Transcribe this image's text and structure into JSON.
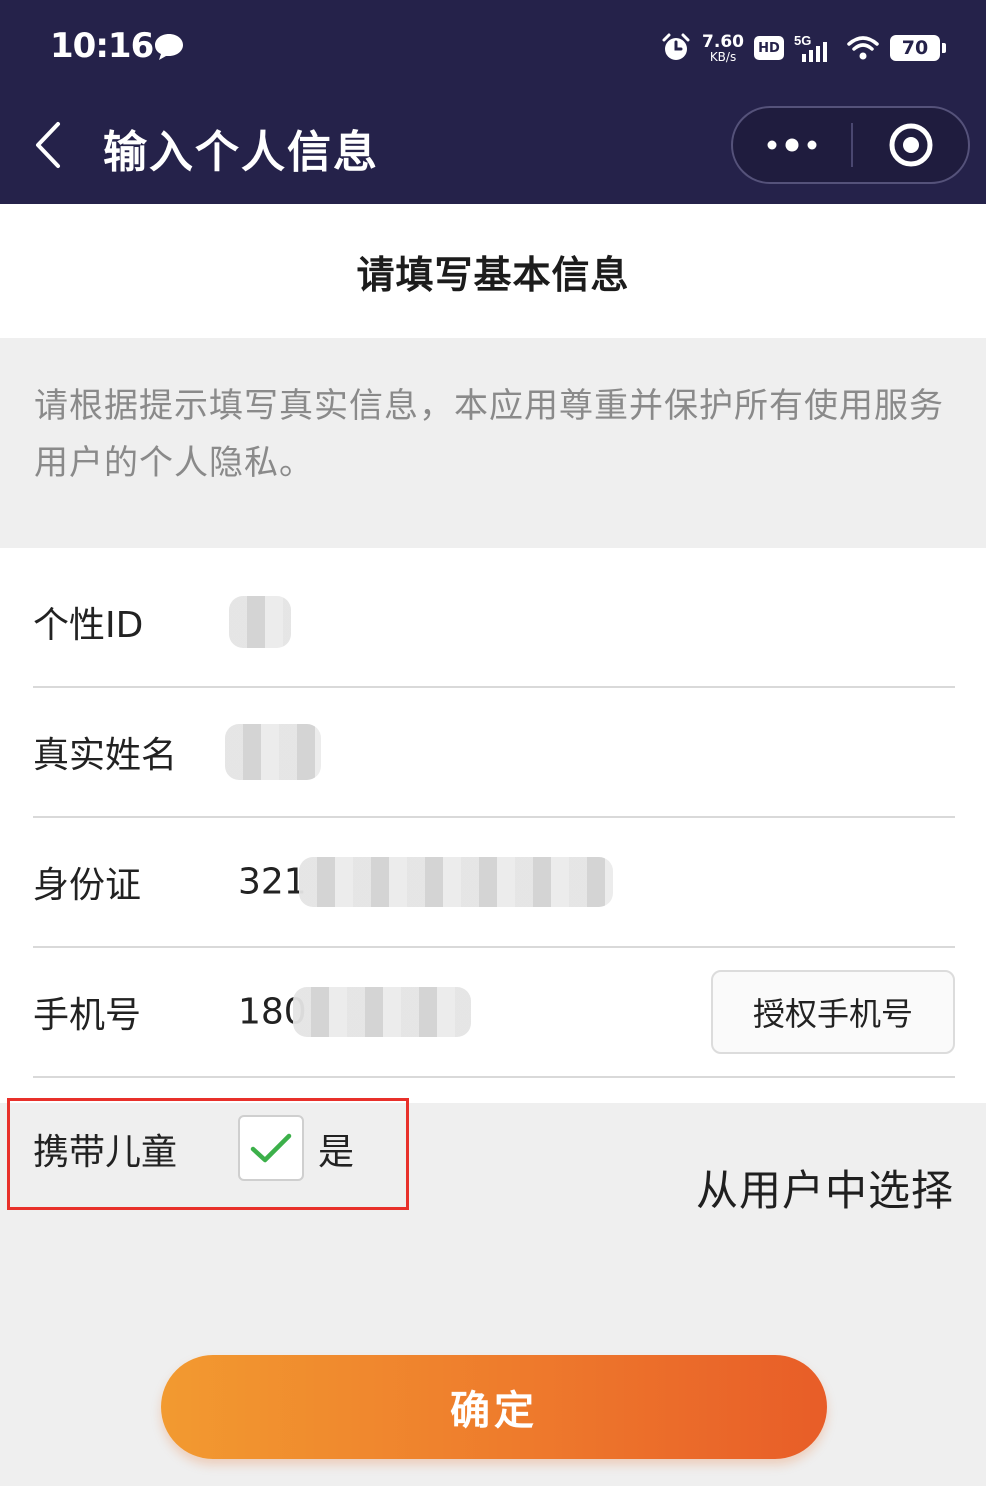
{
  "status_bar": {
    "time": "10:16",
    "net_speed_value": "7.60",
    "net_speed_unit": "KB/s",
    "hd_label": "HD",
    "network": "5G",
    "battery": "70"
  },
  "nav": {
    "title": "输入个人信息",
    "back_icon": "chevron-left-icon",
    "more_icon": "more-dots-icon",
    "close_icon": "target-circle-icon"
  },
  "heading": "请填写基本信息",
  "notice": "请根据提示填写真实信息，本应用尊重并保护所有使用服务用户的个人隐私。",
  "fields": {
    "personal_id": {
      "label": "个性ID",
      "value": ""
    },
    "real_name": {
      "label": "真实姓名",
      "value": ""
    },
    "id_card": {
      "label": "身份证",
      "value": "321"
    },
    "phone": {
      "label": "手机号",
      "value": "180",
      "auth_button": "授权手机号"
    }
  },
  "child": {
    "label": "携带儿童",
    "checked": true,
    "check_text": "是",
    "select_link": "从用户中选择"
  },
  "confirm_button": "确定",
  "colors": {
    "header_bg": "#25224a",
    "accent_gradient_start": "#f29a30",
    "accent_gradient_end": "#e85d28",
    "highlight_border": "#e8302a",
    "check_green": "#3cb04a"
  }
}
